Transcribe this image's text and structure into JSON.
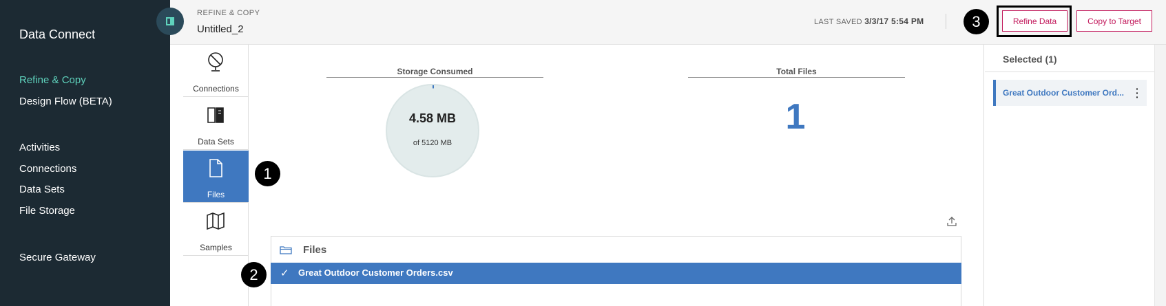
{
  "sidebar": {
    "app_title": "Data Connect",
    "primary": [
      {
        "label": "Refine & Copy",
        "active": true
      },
      {
        "label": "Design Flow (BETA)",
        "active": false
      }
    ],
    "secondary": [
      {
        "label": "Activities"
      },
      {
        "label": "Connections"
      },
      {
        "label": "Data Sets"
      },
      {
        "label": "File Storage"
      }
    ],
    "tertiary": [
      {
        "label": "Secure Gateway"
      }
    ]
  },
  "header": {
    "breadcrumb": "REFINE & COPY",
    "document_name": "Untitled_2",
    "last_saved_label": "LAST SAVED",
    "last_saved_value": "3/3/17 5:54 PM",
    "refine_button": "Refine Data",
    "copy_button": "Copy to Target"
  },
  "tools": [
    {
      "label": "Connections",
      "icon": "connections-icon",
      "active": false
    },
    {
      "label": "Data Sets",
      "icon": "data-sets-icon",
      "active": false
    },
    {
      "label": "Files",
      "icon": "file-icon",
      "active": true
    },
    {
      "label": "Samples",
      "icon": "samples-icon",
      "active": false
    }
  ],
  "storage": {
    "title": "Storage Consumed",
    "used": "4.58 MB",
    "capacity": "of 5120 MB",
    "used_fraction": 0.0009
  },
  "total_files": {
    "title": "Total Files",
    "value": "1"
  },
  "files_list": {
    "heading": "Files",
    "items": [
      {
        "name": "Great Outdoor Customer Orders.csv",
        "selected": true
      }
    ]
  },
  "selected_panel": {
    "title": "Selected (1)",
    "items": [
      {
        "name": "Great Outdoor Customer Ord..."
      }
    ]
  },
  "callouts": [
    "1",
    "2",
    "3"
  ],
  "colors": {
    "sidebar_bg": "#1c2a33",
    "accent_teal": "#5fd3bd",
    "primary_blue": "#3f78c0",
    "button_magenta": "#c2185b"
  }
}
